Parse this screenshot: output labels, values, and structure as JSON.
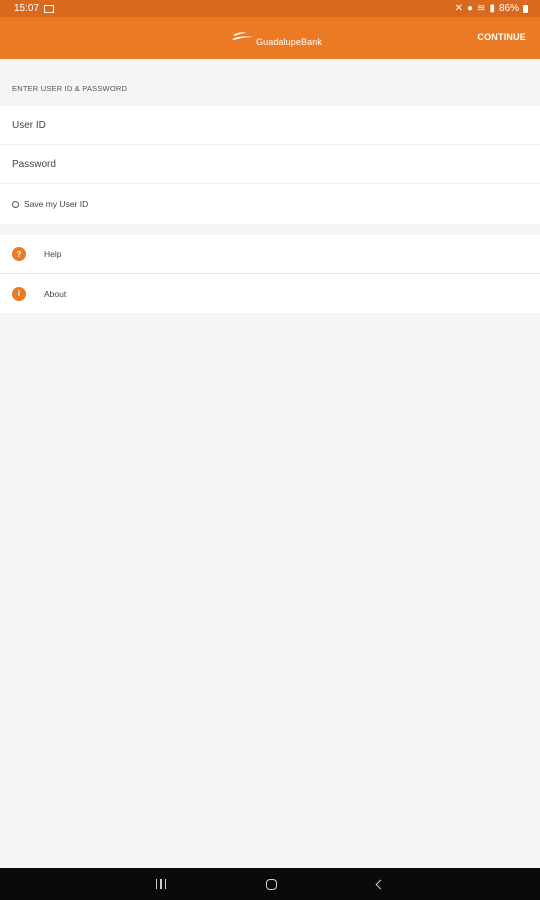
{
  "status_bar": {
    "time": "15:07",
    "battery": "86%"
  },
  "header": {
    "logo_text": "GuadalupeBank",
    "continue_label": "CONTINUE"
  },
  "login": {
    "section_label": "ENTER USER ID & PASSWORD",
    "user_id_placeholder": "User ID",
    "password_placeholder": "Password",
    "save_user_id_label": "Save my User ID"
  },
  "menu": {
    "items": [
      {
        "label": "Help",
        "icon_glyph": "?",
        "icon": "help-icon"
      },
      {
        "label": "About",
        "icon_glyph": "i",
        "icon": "info-icon"
      }
    ]
  },
  "colors": {
    "brand": "#ec7a25",
    "status_bar": "#d9691e"
  }
}
